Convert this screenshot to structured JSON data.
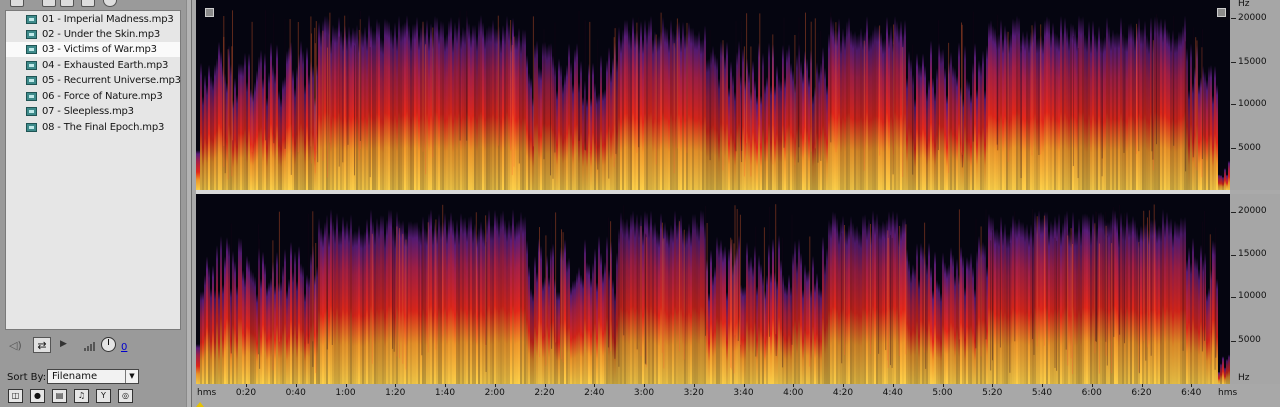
{
  "files": [
    {
      "name": "01 - Imperial Madness.mp3",
      "selected": false
    },
    {
      "name": "02 - Under the Skin.mp3",
      "selected": false
    },
    {
      "name": "03 - Victims of War.mp3",
      "selected": true
    },
    {
      "name": "04 - Exhausted Earth.mp3",
      "selected": false
    },
    {
      "name": "05 - Recurrent Universe.mp3",
      "selected": false
    },
    {
      "name": "06 - Force of Nature.mp3",
      "selected": false
    },
    {
      "name": "07 - Sleepless.mp3",
      "selected": false
    },
    {
      "name": "08 - The Final Epoch.mp3",
      "selected": false
    }
  ],
  "transport": {
    "volume_value": "0",
    "speaker_icon": "speaker-icon",
    "loop_icon": "loop-icon",
    "play_icon": "play-icon"
  },
  "sort": {
    "label": "Sort By:",
    "value": "Filename"
  },
  "freq_ruler": {
    "unit": "Hz",
    "labels": [
      "20000",
      "15000",
      "10000",
      "5000"
    ]
  },
  "time_ruler": {
    "unit": "hms",
    "labels": [
      "0:20",
      "0:40",
      "1:00",
      "1:20",
      "1:40",
      "2:00",
      "2:20",
      "2:40",
      "3:00",
      "3:20",
      "3:40",
      "4:00",
      "4:20",
      "4:40",
      "5:00",
      "5:20",
      "5:40",
      "6:00",
      "6:20",
      "6:40"
    ]
  },
  "colors": {
    "spec_low": "#ffd24a",
    "spec_mid": "#e8281a",
    "spec_high": "#5a1c7a",
    "background": "#050510"
  }
}
